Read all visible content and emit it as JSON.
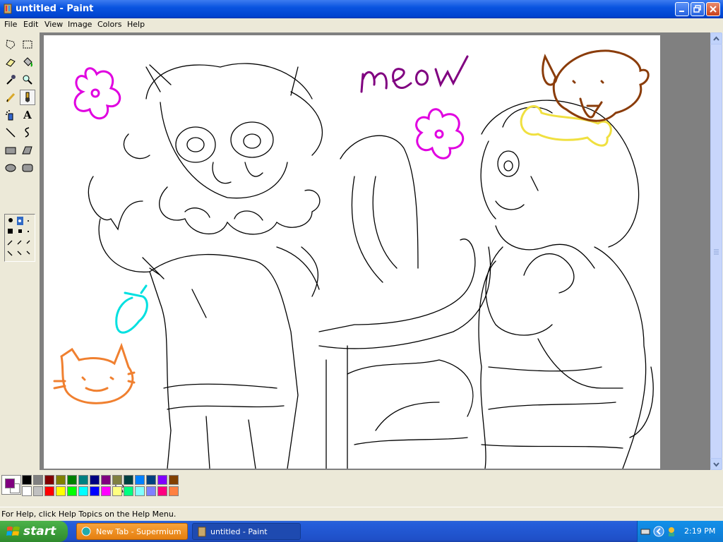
{
  "window": {
    "title": "untitled - Paint"
  },
  "menu": {
    "items": [
      "File",
      "Edit",
      "View",
      "Image",
      "Colors",
      "Help"
    ]
  },
  "tools": [
    "free-form-select",
    "select",
    "eraser",
    "fill-with-color",
    "pick-color",
    "magnifier",
    "pencil",
    "brush",
    "airbrush",
    "text",
    "line",
    "curve",
    "rectangle",
    "polygon",
    "ellipse",
    "rounded-rectangle"
  ],
  "drawing": {
    "text": "meow"
  },
  "palette": {
    "foreground": "#800080",
    "background": "#ffffff",
    "colors_top": [
      "#000000",
      "#808080",
      "#800000",
      "#808000",
      "#008000",
      "#008080",
      "#000080",
      "#800080",
      "#808040",
      "#004040",
      "#0080ff",
      "#004080",
      "#8000ff",
      "#804000"
    ],
    "colors_bottom": [
      "#ffffff",
      "#c0c0c0",
      "#ff0000",
      "#ffff00",
      "#00ff00",
      "#00ffff",
      "#0000ff",
      "#ff00ff",
      "#ffff80",
      "#00ff80",
      "#80ffff",
      "#8080ff",
      "#ff0080",
      "#ff8040"
    ]
  },
  "status": {
    "text": "For Help, click Help Topics on the Help Menu."
  },
  "taskbar": {
    "start_label": "start",
    "tasks": [
      "New Tab - Supermium",
      "untitled - Paint"
    ],
    "clock": "2:19 PM"
  }
}
